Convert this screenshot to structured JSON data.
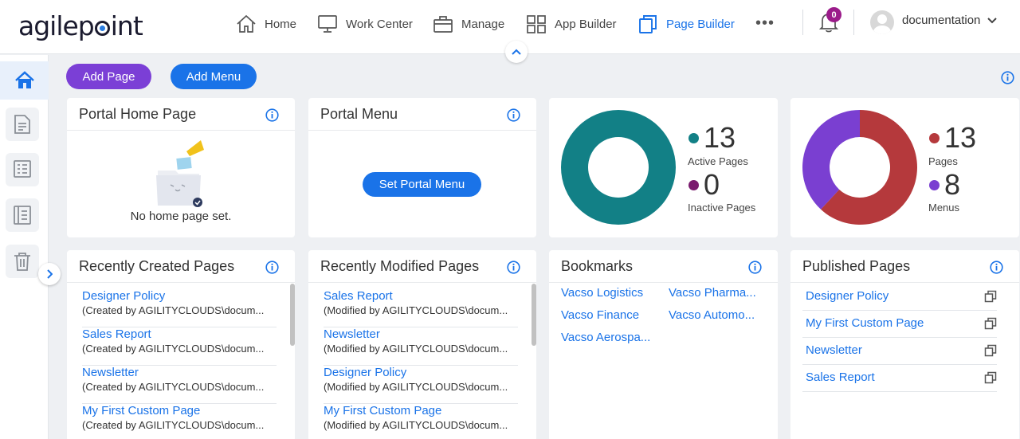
{
  "header": {
    "logo_left": "agilep",
    "logo_right": "int",
    "nav": [
      {
        "label": "Home",
        "icon": "home-icon"
      },
      {
        "label": "Work Center",
        "icon": "monitor-icon"
      },
      {
        "label": "Manage",
        "icon": "briefcase-icon"
      },
      {
        "label": "App Builder",
        "icon": "grid-icon"
      },
      {
        "label": "Page Builder",
        "icon": "copy-pages-icon",
        "active": true
      }
    ],
    "more_label": "•••",
    "notifications_count": "0",
    "username": "documentation"
  },
  "sidebar": {
    "items": [
      "home-icon",
      "page-icon",
      "menu-list-icon",
      "list-icon",
      "trash-icon"
    ]
  },
  "actions": {
    "add_page": "Add Page",
    "add_menu": "Add Menu"
  },
  "portal_home": {
    "title": "Portal Home Page",
    "empty_text": "No home page set."
  },
  "portal_menu": {
    "title": "Portal Menu",
    "button": "Set Portal Menu"
  },
  "pages_stats": {
    "active_count": "13",
    "active_label": "Active Pages",
    "inactive_count": "0",
    "inactive_label": "Inactive Pages",
    "colors": {
      "active": "#128086",
      "inactive": "#7a1b6e"
    },
    "chart_data": {
      "type": "pie",
      "categories": [
        "Active Pages",
        "Inactive Pages"
      ],
      "values": [
        13,
        0
      ]
    }
  },
  "pages_menus_stats": {
    "pages_count": "13",
    "pages_label": "Pages",
    "menus_count": "8",
    "menus_label": "Menus",
    "colors": {
      "pages": "#b5393c",
      "menus": "#7a3fd1"
    },
    "chart_data": {
      "type": "pie",
      "categories": [
        "Pages",
        "Menus"
      ],
      "values": [
        13,
        8
      ]
    }
  },
  "recently_created": {
    "title": "Recently Created Pages",
    "items": [
      {
        "name": "Designer Policy",
        "sub": "(Created by AGILITYCLOUDS\\docum..."
      },
      {
        "name": "Sales Report",
        "sub": "(Created by AGILITYCLOUDS\\docum..."
      },
      {
        "name": "Newsletter",
        "sub": "(Created by AGILITYCLOUDS\\docum..."
      },
      {
        "name": "My First Custom Page",
        "sub": "(Created by AGILITYCLOUDS\\docum..."
      }
    ]
  },
  "recently_modified": {
    "title": "Recently Modified Pages",
    "items": [
      {
        "name": "Sales Report",
        "sub": "(Modified by AGILITYCLOUDS\\docum..."
      },
      {
        "name": "Newsletter",
        "sub": "(Modified by AGILITYCLOUDS\\docum..."
      },
      {
        "name": "Designer Policy",
        "sub": "(Modified by AGILITYCLOUDS\\docum..."
      },
      {
        "name": "My First Custom Page",
        "sub": "(Modified by AGILITYCLOUDS\\docum..."
      }
    ]
  },
  "bookmarks": {
    "title": "Bookmarks",
    "items": [
      "Vacso Logistics",
      "Vacso Pharma...",
      "Vacso Finance",
      "Vacso Automo...",
      "Vacso Aerospa..."
    ]
  },
  "published": {
    "title": "Published Pages",
    "items": [
      "Designer Policy",
      "My First Custom Page",
      "Newsletter",
      "Sales Report"
    ]
  }
}
